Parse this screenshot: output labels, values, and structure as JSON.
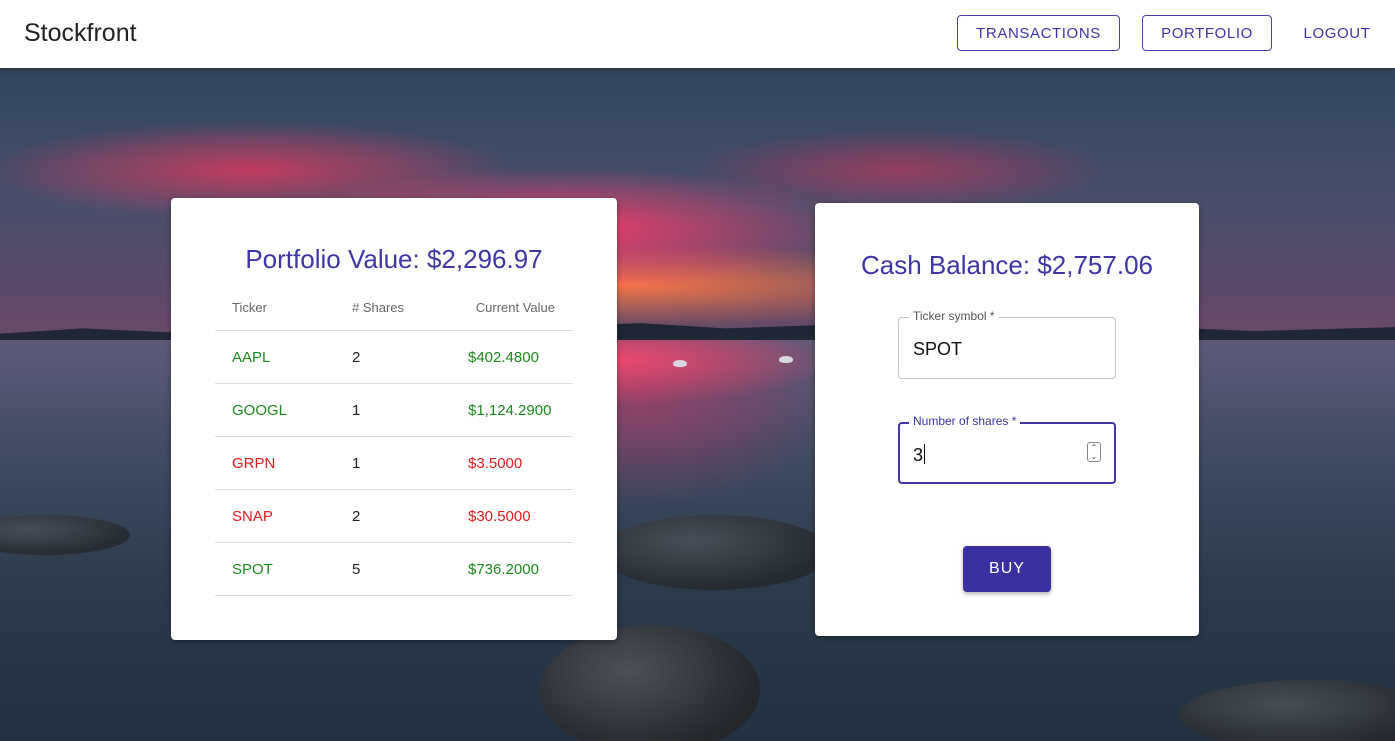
{
  "app": {
    "title": "Stockfront"
  },
  "nav": {
    "transactions": "TRANSACTIONS",
    "portfolio": "PORTFOLIO",
    "logout": "LOGOUT"
  },
  "portfolio": {
    "title": "Portfolio Value: $2,296.97",
    "headers": {
      "ticker": "Ticker",
      "shares": "# Shares",
      "value": "Current Value"
    },
    "rows": [
      {
        "ticker": "AAPL",
        "shares": "2",
        "value": "$402.4800",
        "trend": "up"
      },
      {
        "ticker": "GOOGL",
        "shares": "1",
        "value": "$1,124.2900",
        "trend": "up"
      },
      {
        "ticker": "GRPN",
        "shares": "1",
        "value": "$3.5000",
        "trend": "down"
      },
      {
        "ticker": "SNAP",
        "shares": "2",
        "value": "$30.5000",
        "trend": "down"
      },
      {
        "ticker": "SPOT",
        "shares": "5",
        "value": "$736.2000",
        "trend": "up"
      }
    ]
  },
  "trade": {
    "title": "Cash Balance: $2,757.06",
    "ticker_label": "Ticker symbol *",
    "ticker_value": "SPOT",
    "shares_label": "Number of shares *",
    "shares_value": "3",
    "buy_label": "BUY"
  },
  "colors": {
    "accent": "#3f35a6",
    "positive": "#1e8a1e",
    "negative": "#e01b1b"
  }
}
